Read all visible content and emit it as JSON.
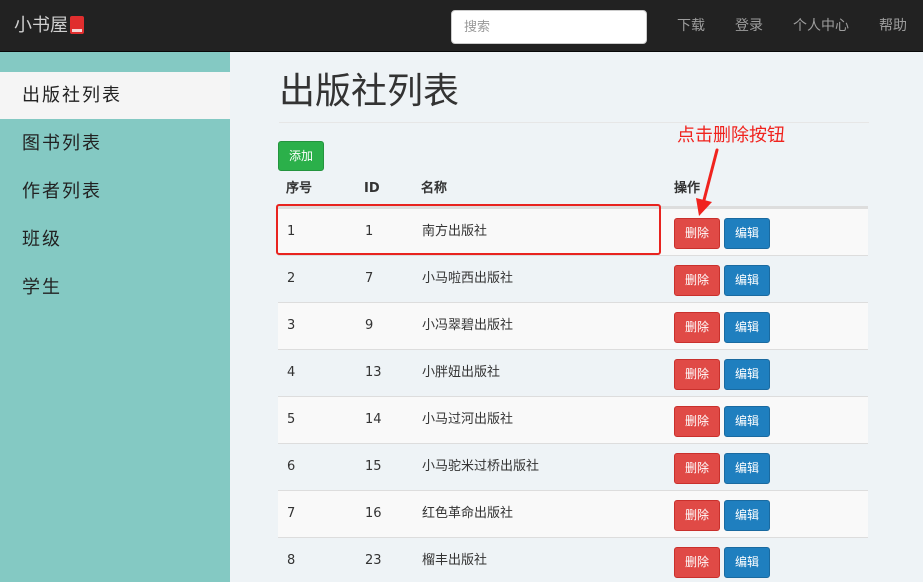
{
  "navbar": {
    "brand": "小书屋",
    "search_placeholder": "搜索",
    "links": [
      "下载",
      "登录",
      "个人中心",
      "帮助"
    ]
  },
  "sidebar": {
    "items": [
      "出版社列表",
      "图书列表",
      "作者列表",
      "班级",
      "学生"
    ],
    "active_index": 0
  },
  "main": {
    "title": "出版社列表",
    "add_label": "添加",
    "columns": [
      "序号",
      "ID",
      "名称",
      "操作"
    ],
    "delete_label": "删除",
    "edit_label": "编辑",
    "rows": [
      {
        "index": "1",
        "id": "1",
        "name": "南方出版社"
      },
      {
        "index": "2",
        "id": "7",
        "name": "小马啦西出版社"
      },
      {
        "index": "3",
        "id": "9",
        "name": "小冯翠碧出版社"
      },
      {
        "index": "4",
        "id": "13",
        "name": "小胖妞出版社"
      },
      {
        "index": "5",
        "id": "14",
        "name": "小马过河出版社"
      },
      {
        "index": "6",
        "id": "15",
        "name": "小马驼米过桥出版社"
      },
      {
        "index": "7",
        "id": "16",
        "name": "红色革命出版社"
      },
      {
        "index": "8",
        "id": "23",
        "name": "榴丰出版社"
      }
    ]
  },
  "annotation": {
    "callout": "点击删除按钮"
  },
  "colors": {
    "navbar_bg": "#222222",
    "sidebar_bg": "#84c9c3",
    "add_button": "#2bb04a",
    "delete_button": "#e04a46",
    "edit_button": "#1f7fbf",
    "annotation_red": "#f0231e"
  }
}
